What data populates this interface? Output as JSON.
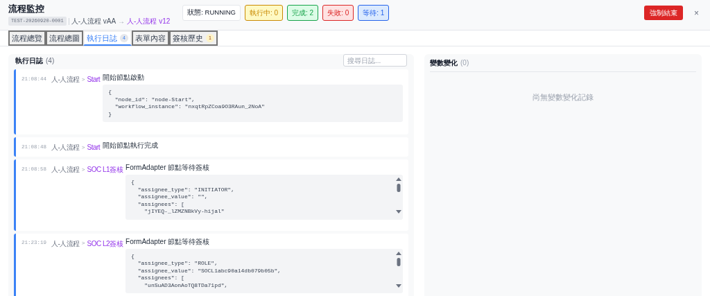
{
  "header": {
    "title": "流程監控",
    "instance_id": "TEST-20260920-0001",
    "source_flow": "人-人流程 vAA",
    "arrow": "→",
    "target_flow": "人-人流程 v12"
  },
  "status": {
    "label": "狀態: RUNNING"
  },
  "counters": [
    {
      "label": "執行中: 0",
      "color": "#ca8a04"
    },
    {
      "label": "完成: 2",
      "color": "#16a34a"
    },
    {
      "label": "失敗: 0",
      "color": "#dc2626"
    },
    {
      "label": "等待: 1",
      "color": "#2563eb"
    }
  ],
  "actions": {
    "force_end": "強制結束",
    "close": "×"
  },
  "tabs": [
    {
      "label": "流程總覽",
      "selected": false
    },
    {
      "label": "流程總圖",
      "selected": false
    },
    {
      "label": "執行日誌",
      "selected": true,
      "badge": "4"
    },
    {
      "label": "表單內容",
      "selected": false
    },
    {
      "label": "簽核歷史",
      "selected": false,
      "badge": "1"
    }
  ],
  "log_panel": {
    "title": "執行日誌",
    "count": "(4)",
    "search_placeholder": "搜尋日誌...",
    "entries": [
      {
        "kind": "detail",
        "time": "21:08:44",
        "flow": "人-人流程",
        "separator": ">",
        "node": "Start",
        "message": "開始節點啟動",
        "code": [
          "{",
          "  \"node_id\": \"node-Start\",",
          "  \"workflow_instance\": \"nxqtRpZCoa9O3RAun_2NoA\"",
          "}"
        ]
      },
      {
        "kind": "text",
        "time": "21:08:48",
        "flow": "人-人流程",
        "separator": ">",
        "node": "Start",
        "message": "開始節點執行完成"
      },
      {
        "kind": "scroll",
        "time": "21:08:58",
        "flow": "人-人流程",
        "separator": ">",
        "node": "SOC L1簽核",
        "message": "FormAdapter 節點等待簽核",
        "code": [
          "{",
          "  \"assignee_type\": \"INITIATOR\",",
          "  \"assignee_value\": \"\",",
          "  \"assignees\": [",
          "    \"jIYEQ-_lZMZNBkVy-hijal\""
        ]
      },
      {
        "kind": "scroll",
        "time": "21:23:19",
        "flow": "人-人流程",
        "separator": ">",
        "node": "SOC L2簽核",
        "message": "FormAdapter 節點等待簽核",
        "code": [
          "{",
          "  \"assignee_type\": \"ROLE\",",
          "  \"assignee_value\": \"SOCL1abc90a14db079b05b\",",
          "  \"assignees\": [",
          "    \"unSuAD3AonAoTQ8TDa71pd\","
        ]
      }
    ]
  },
  "variables_panel": {
    "title": "變數變化",
    "count": "(0)",
    "empty_text": "尚無變數變化記錄"
  }
}
